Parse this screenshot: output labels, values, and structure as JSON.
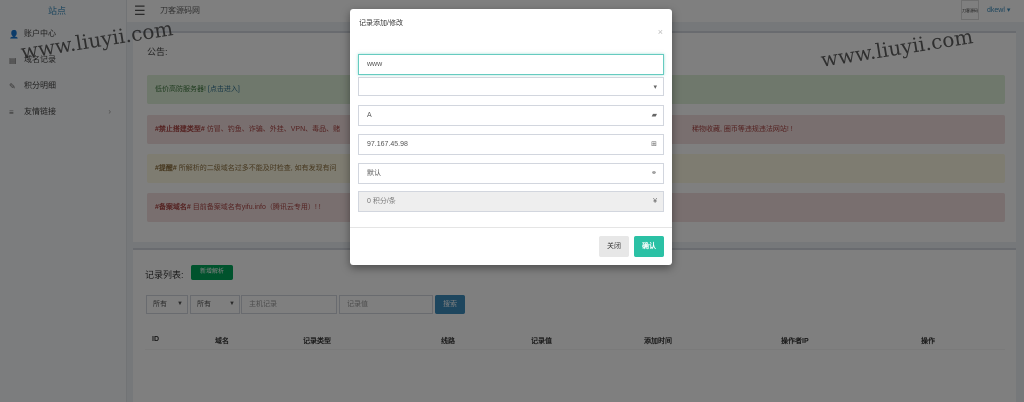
{
  "logo": {
    "alt": "站点"
  },
  "sidebar": {
    "items": [
      {
        "label": "账户中心",
        "icon": "user-icon"
      },
      {
        "label": "域名记录",
        "icon": "record-icon"
      },
      {
        "label": "积分明细",
        "icon": "pencil-icon"
      },
      {
        "label": "友情链接",
        "icon": "list-icon",
        "caret": "›"
      }
    ]
  },
  "header": {
    "site_name": "刀客源码网",
    "avatar_label": "刀客源码",
    "user": "dkewl ▾"
  },
  "notice": {
    "title": "公告:",
    "alerts": [
      {
        "type": "green",
        "text": "低价高防服务器! ",
        "link": "[点击进入]"
      },
      {
        "type": "red",
        "bold": "#禁止搭建类型#",
        "text": " 仿冒、钓鱼、诈骗、外挂、VPN、毒品、赌",
        "right": "稀物收藏, 圈币等违规违法网站! !"
      },
      {
        "type": "yellow",
        "bold": "#提醒#",
        "text": " 所解析的二级域名过多不能及时检查, 如有发现有问"
      },
      {
        "type": "red",
        "bold": "#备案域名#",
        "text": " 目前备案域名有yifu.info（腾讯云专用）! !"
      }
    ]
  },
  "records": {
    "title": "记录列表:",
    "new_button": "新增解析",
    "filter1": "所有",
    "filter2": "所有",
    "host_placeholder": "主机记录",
    "value_placeholder": "记录值",
    "search_button": "搜索",
    "columns": [
      "ID",
      "域名",
      "记录类型",
      "线路",
      "记录值",
      "添加时间",
      "操作者IP",
      "操作"
    ]
  },
  "modal": {
    "title": "记录添加/修改",
    "close_x": "×",
    "host_value": "www",
    "domain_select": "",
    "type_value": "A",
    "ip_value": "97.167.45.98",
    "line_value": "默认",
    "points_value": "0 积分/条",
    "close_button": "关闭",
    "confirm_button": "确认"
  },
  "watermark": "www.liuyii.com"
}
